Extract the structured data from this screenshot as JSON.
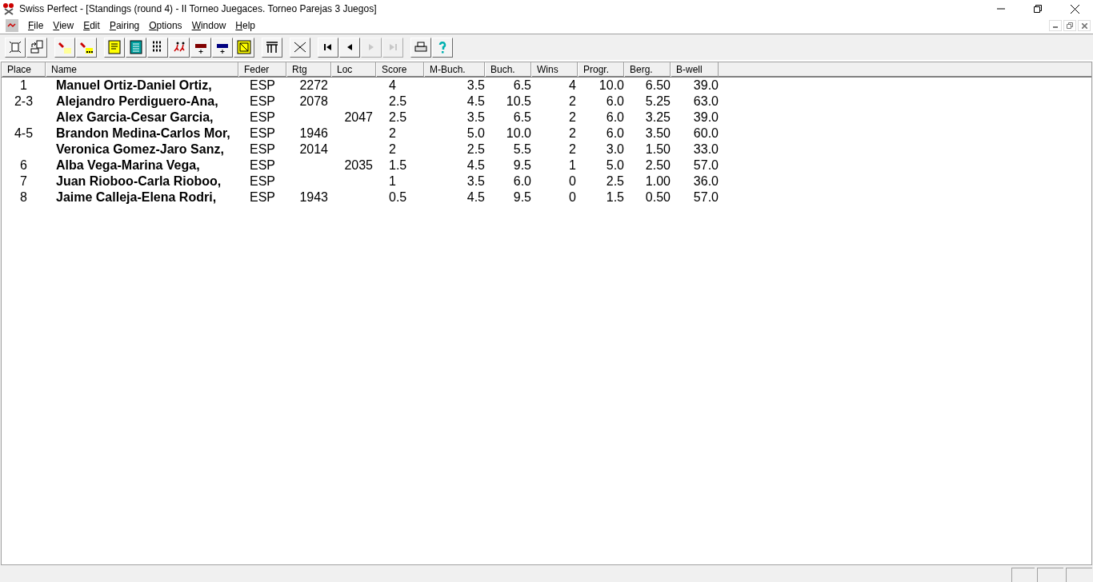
{
  "window": {
    "title": "Swiss Perfect - [Standings  (round 4) - II Torneo Juegaces. Torneo Parejas 3 Juegos]"
  },
  "menu": [
    "File",
    "View",
    "Edit",
    "Pairing",
    "Options",
    "Window",
    "Help"
  ],
  "toolbar": [
    [
      {
        "kind": "new",
        "disabled": false
      },
      {
        "kind": "open",
        "disabled": false
      }
    ],
    [
      {
        "kind": "torch",
        "disabled": false
      },
      {
        "kind": "torch-dots",
        "disabled": false
      }
    ],
    [
      {
        "kind": "list",
        "disabled": false
      },
      {
        "kind": "grid",
        "disabled": false
      },
      {
        "kind": "binary",
        "disabled": false
      },
      {
        "kind": "runners",
        "disabled": false
      },
      {
        "kind": "rating-red",
        "disabled": false
      },
      {
        "kind": "rating-blue",
        "disabled": false
      },
      {
        "kind": "image",
        "disabled": false
      }
    ],
    [
      {
        "kind": "table",
        "disabled": false
      }
    ],
    [
      {
        "kind": "cross",
        "disabled": false
      }
    ],
    [
      {
        "kind": "first",
        "disabled": false
      },
      {
        "kind": "prev",
        "disabled": false
      },
      {
        "kind": "next",
        "disabled": true
      },
      {
        "kind": "last",
        "disabled": true
      }
    ],
    [
      {
        "kind": "print",
        "disabled": false
      },
      {
        "kind": "help",
        "disabled": false
      }
    ]
  ],
  "table": {
    "columns": [
      "Place",
      "Name",
      "Feder",
      "Rtg",
      "Loc",
      "Score",
      "M-Buch.",
      "Buch.",
      "Wins",
      "Progr.",
      "Berg.",
      "B-well"
    ],
    "rows": [
      [
        "1",
        "Manuel Ortiz-Daniel Ortiz,",
        "ESP",
        "2272",
        "",
        "4",
        "3.5",
        "6.5",
        "4",
        "10.0",
        "6.50",
        "39.0"
      ],
      [
        "2-3",
        "Alejandro Perdiguero-Ana,",
        "ESP",
        "2078",
        "",
        "2.5",
        "4.5",
        "10.5",
        "2",
        "6.0",
        "5.25",
        "63.0"
      ],
      [
        "",
        "Alex Garcia-Cesar Garcia,",
        "ESP",
        "",
        "2047",
        "2.5",
        "3.5",
        "6.5",
        "2",
        "6.0",
        "3.25",
        "39.0"
      ],
      [
        "4-5",
        "Brandon Medina-Carlos Mor,",
        "ESP",
        "1946",
        "",
        "2",
        "5.0",
        "10.0",
        "2",
        "6.0",
        "3.50",
        "60.0"
      ],
      [
        "",
        "Veronica Gomez-Jaro Sanz,",
        "ESP",
        "2014",
        "",
        "2",
        "2.5",
        "5.5",
        "2",
        "3.0",
        "1.50",
        "33.0"
      ],
      [
        "6",
        "Alba Vega-Marina Vega,",
        "ESP",
        "",
        "2035",
        "1.5",
        "4.5",
        "9.5",
        "1",
        "5.0",
        "2.50",
        "57.0"
      ],
      [
        "7",
        "Juan Rioboo-Carla Rioboo,",
        "ESP",
        "",
        "",
        "1",
        "3.5",
        "6.0",
        "0",
        "2.5",
        "1.00",
        "36.0"
      ],
      [
        "8",
        "Jaime Calleja-Elena Rodri,",
        "ESP",
        "1943",
        "",
        "0.5",
        "4.5",
        "9.5",
        "0",
        "1.5",
        "0.50",
        "57.0"
      ]
    ]
  }
}
